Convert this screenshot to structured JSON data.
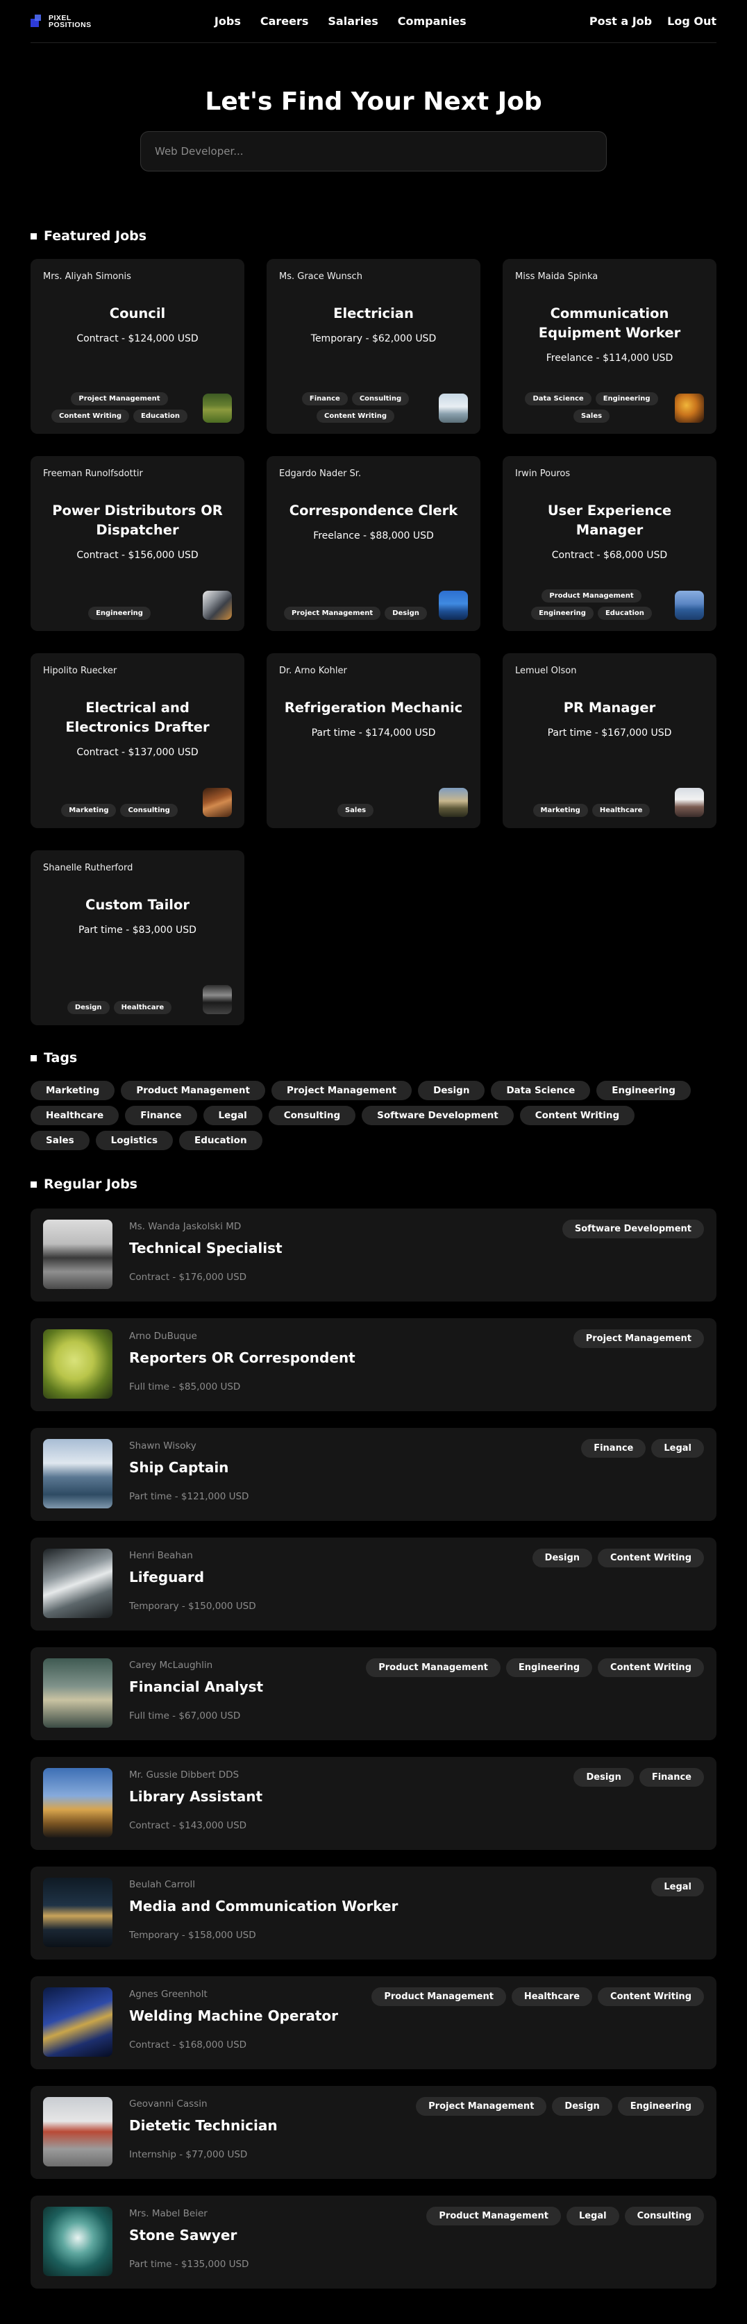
{
  "nav": {
    "logo_text_line1": "PIXEL",
    "logo_text_line2": "POSITIONS",
    "links": [
      "Jobs",
      "Careers",
      "Salaries",
      "Companies"
    ],
    "post_job": "Post a Job",
    "logout": "Log Out"
  },
  "hero": {
    "title": "Let's Find Your Next Job",
    "search_placeholder": "Web Developer..."
  },
  "featured": {
    "heading": "Featured Jobs",
    "jobs": [
      {
        "employer": "Mrs. Aliyah Simonis",
        "title": "Council",
        "salary": "Contract - $124,000 USD",
        "tags": [
          "Project Management",
          "Content Writing",
          "Education"
        ],
        "thumb": "field"
      },
      {
        "employer": "Ms. Grace Wunsch",
        "title": "Electrician",
        "salary": "Temporary - $62,000 USD",
        "tags": [
          "Finance",
          "Consulting",
          "Content Writing"
        ],
        "thumb": "snow-mountain"
      },
      {
        "employer": "Miss Maida Spinka",
        "title": "Communication Equipment Worker",
        "salary": "Freelance - $114,000 USD",
        "tags": [
          "Data Science",
          "Engineering",
          "Sales"
        ],
        "thumb": "food"
      },
      {
        "employer": "Freeman Runolfsdottir",
        "title": "Power Distributors OR Dispatcher",
        "salary": "Contract - $156,000 USD",
        "tags": [
          "Engineering"
        ],
        "thumb": "laptop"
      },
      {
        "employer": "Edgardo Nader Sr.",
        "title": "Correspondence Clerk",
        "salary": "Freelance - $88,000 USD",
        "tags": [
          "Project Management",
          "Design"
        ],
        "thumb": "blue-mountain"
      },
      {
        "employer": "Irwin Pouros",
        "title": "User Experience Manager",
        "salary": "Contract - $68,000 USD",
        "tags": [
          "Product Management",
          "Engineering",
          "Education"
        ],
        "thumb": "sea"
      },
      {
        "employer": "Hipolito Ruecker",
        "title": "Electrical and Electronics Drafter",
        "salary": "Contract - $137,000 USD",
        "tags": [
          "Marketing",
          "Consulting"
        ],
        "thumb": "brown"
      },
      {
        "employer": "Dr. Arno Kohler",
        "title": "Refrigeration Mechanic",
        "salary": "Part time - $174,000 USD",
        "tags": [
          "Sales"
        ],
        "thumb": "landscape"
      },
      {
        "employer": "Lemuel Olson",
        "title": "PR Manager",
        "salary": "Part time - $167,000 USD",
        "tags": [
          "Marketing",
          "Healthcare"
        ],
        "thumb": "building"
      },
      {
        "employer": "Shanelle Rutherford",
        "title": "Custom Tailor",
        "salary": "Part time - $83,000 USD",
        "tags": [
          "Design",
          "Healthcare"
        ],
        "thumb": "device"
      }
    ]
  },
  "tags_section": {
    "heading": "Tags",
    "tags": [
      "Marketing",
      "Product Management",
      "Project Management",
      "Design",
      "Data Science",
      "Engineering",
      "Healthcare",
      "Finance",
      "Legal",
      "Consulting",
      "Software Development",
      "Content Writing",
      "Sales",
      "Logistics",
      "Education"
    ]
  },
  "regular": {
    "heading": "Regular Jobs",
    "jobs": [
      {
        "employer": "Ms. Wanda Jaskolski MD",
        "title": "Technical Specialist",
        "salary": "Contract - $176,000 USD",
        "tags": [
          "Software Development"
        ],
        "thumb": "coast-bw"
      },
      {
        "employer": "Arno DuBuque",
        "title": "Reporters OR Correspondent",
        "salary": "Full time - $85,000 USD",
        "tags": [
          "Project Management"
        ],
        "thumb": "leaf"
      },
      {
        "employer": "Shawn Wisoky",
        "title": "Ship Captain",
        "salary": "Part time - $121,000 USD",
        "tags": [
          "Finance",
          "Legal"
        ],
        "thumb": "waves"
      },
      {
        "employer": "Henri Beahan",
        "title": "Lifeguard",
        "salary": "Temporary - $150,000 USD",
        "tags": [
          "Design",
          "Content Writing"
        ],
        "thumb": "splash"
      },
      {
        "employer": "Carey McLaughlin",
        "title": "Financial Analyst",
        "salary": "Full time - $67,000 USD",
        "tags": [
          "Product Management",
          "Engineering",
          "Content Writing"
        ],
        "thumb": "clouds"
      },
      {
        "employer": "Mr. Gussie Dibbert DDS",
        "title": "Library Assistant",
        "salary": "Contract - $143,000 USD",
        "tags": [
          "Design",
          "Finance"
        ],
        "thumb": "desert"
      },
      {
        "employer": "Beulah Carroll",
        "title": "Media and Communication Worker",
        "salary": "Temporary - $158,000 USD",
        "tags": [
          "Legal"
        ],
        "thumb": "night-lights"
      },
      {
        "employer": "Agnes Greenholt",
        "title": "Welding Machine Operator",
        "salary": "Contract - $168,000 USD",
        "tags": [
          "Product Management",
          "Healthcare",
          "Content Writing"
        ],
        "thumb": "bridge-night"
      },
      {
        "employer": "Geovanni Cassin",
        "title": "Dietetic Technician",
        "salary": "Internship - $77,000 USD",
        "tags": [
          "Project Management",
          "Design",
          "Engineering"
        ],
        "thumb": "golden-gate"
      },
      {
        "employer": "Mrs. Mabel Beier",
        "title": "Stone Sawyer",
        "salary": "Part time - $135,000 USD",
        "tags": [
          "Product Management",
          "Legal",
          "Consulting"
        ],
        "thumb": "tunnel"
      }
    ]
  }
}
